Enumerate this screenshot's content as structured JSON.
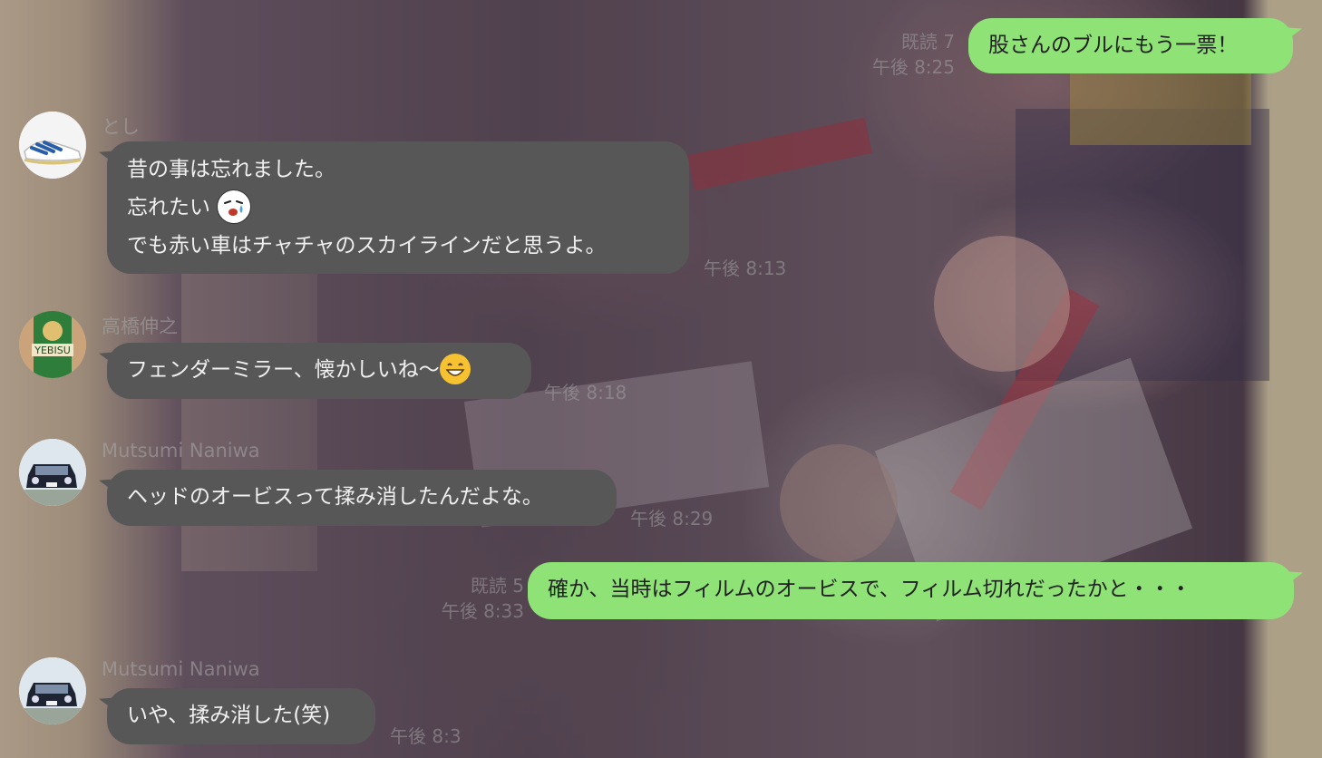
{
  "colors": {
    "sent_bubble": "#8ee276",
    "received_bubble": "#575757",
    "received_text": "#f0f0f0"
  },
  "messages": [
    {
      "direction": "sent",
      "text": "股さんのブルにもう一票！",
      "read_label": "既読 7",
      "time": "午後 8:25"
    },
    {
      "direction": "received",
      "sender": "とし",
      "avatar_icon": "sneaker-avatar-icon",
      "lines": [
        "昔の事は忘れました。",
        "忘れたい",
        "でも赤い車はチャチャのスカイラインだと思うよ。"
      ],
      "emoji_icon": "crying-face-sticker-icon",
      "time": "午後 8:13"
    },
    {
      "direction": "received",
      "sender": "高橋伸之",
      "avatar_icon": "beer-can-avatar-icon",
      "avatar_text": "YEBISU",
      "text": "フェンダーミラー、懐かしいね〜",
      "emoji_icon": "grinning-face-emoji-icon",
      "time": "午後 8:18"
    },
    {
      "direction": "received",
      "sender": "Mutsumi Naniwa",
      "avatar_icon": "classic-car-avatar-icon",
      "text": "ヘッドのオービスって揉み消したんだよな。",
      "time": "午後 8:29"
    },
    {
      "direction": "sent",
      "text": "確か、当時はフィルムのオービスで、フィルム切れだったかと・・・",
      "read_label": "既読 5",
      "time": "午後 8:33"
    },
    {
      "direction": "received",
      "sender": "Mutsumi Naniwa",
      "avatar_icon": "classic-car-avatar-icon",
      "text": "いや、揉み消した(笑)",
      "time": "午後 8:3"
    }
  ]
}
